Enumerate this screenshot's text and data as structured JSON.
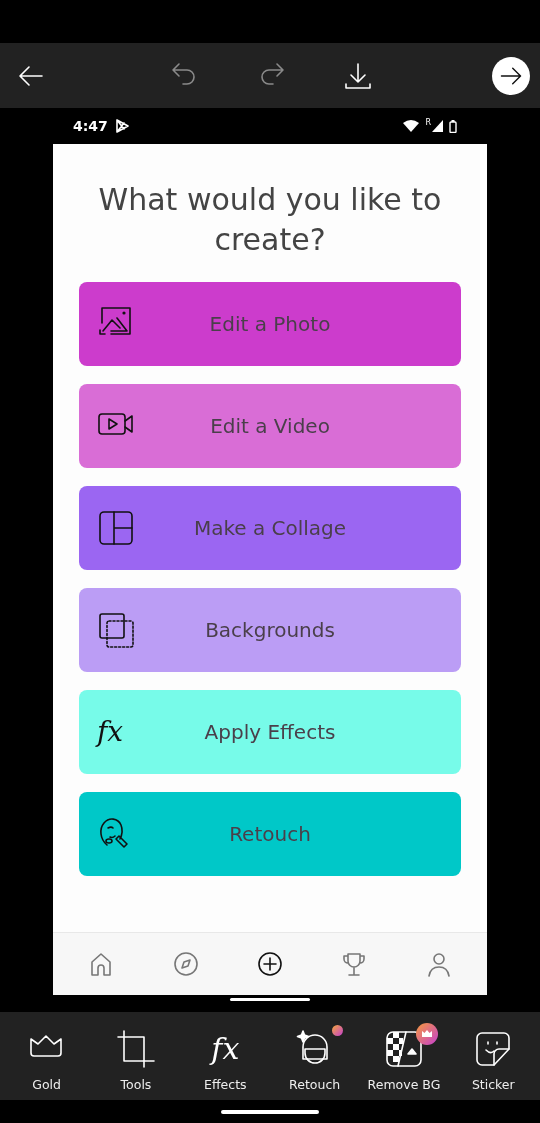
{
  "toolbar": {
    "buttons": [
      {
        "kind": "back",
        "disabled": false
      },
      {
        "kind": "undo",
        "disabled": true
      },
      {
        "kind": "redo",
        "disabled": true
      },
      {
        "kind": "download",
        "disabled": false
      },
      {
        "kind": "next",
        "disabled": false
      }
    ]
  },
  "status_bar": {
    "time": "4:47",
    "roaming": "R"
  },
  "heading": "What would you like to create?",
  "options": [
    {
      "label": "Edit a Photo",
      "kind": "photo",
      "color": "#cc3ccc"
    },
    {
      "label": "Edit a Video",
      "kind": "video",
      "color": "#d96dd6"
    },
    {
      "label": "Make a Collage",
      "kind": "collage",
      "color": "#9b66f2"
    },
    {
      "label": "Backgrounds",
      "kind": "backgrounds",
      "color": "#bb9df5"
    },
    {
      "label": "Apply Effects",
      "kind": "effects",
      "icon_text": "fx",
      "color": "#77fbe9"
    },
    {
      "label": "Retouch",
      "kind": "retouch",
      "color": "#00c8c8"
    }
  ],
  "nav": [
    {
      "kind": "home",
      "selected": false
    },
    {
      "kind": "explore",
      "selected": false
    },
    {
      "kind": "create",
      "selected": true
    },
    {
      "kind": "challenges",
      "selected": false
    },
    {
      "kind": "profile",
      "selected": false
    }
  ],
  "tools": [
    {
      "label": "Gold",
      "kind": "crown",
      "new_dot": false,
      "premium": false
    },
    {
      "label": "Tools",
      "kind": "crop",
      "new_dot": false,
      "premium": false
    },
    {
      "label": "Effects",
      "kind": "effects",
      "icon_text": "fx",
      "new_dot": false,
      "premium": false
    },
    {
      "label": "Retouch",
      "kind": "face",
      "new_dot": true,
      "premium": false
    },
    {
      "label": "Remove BG",
      "kind": "removebg",
      "new_dot": false,
      "premium": true
    },
    {
      "label": "Sticker",
      "kind": "sticker",
      "new_dot": false,
      "premium": false
    }
  ]
}
